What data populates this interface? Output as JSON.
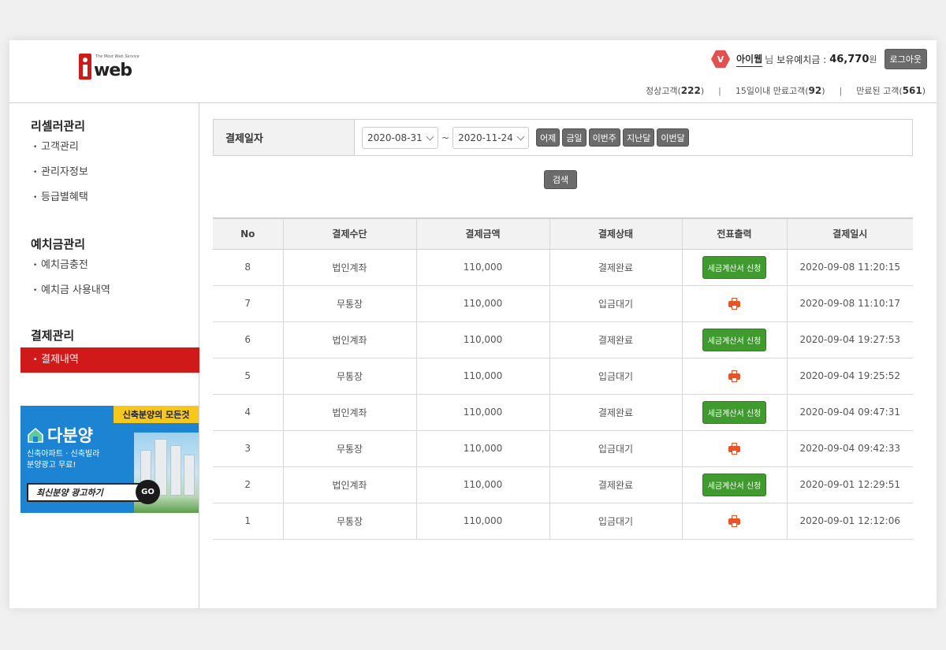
{
  "header": {
    "logo_text": "web",
    "logo_tagline": "The Most Web Service",
    "vip_badge": "V",
    "user_name": "아이웹",
    "user_suffix": "님",
    "deposit_label": "보유예치금 :",
    "deposit_value": "46,770",
    "deposit_unit": "원",
    "logout_label": "로그아웃",
    "stats": [
      {
        "label": "정상고객",
        "count": "222"
      },
      {
        "label": "15일이내 만료고객",
        "count": "92"
      },
      {
        "label": "만료된 고객",
        "count": "561"
      }
    ],
    "stats_separator": "|"
  },
  "sidebar": {
    "groups": [
      {
        "title": "리셀러관리",
        "items": [
          "고객관리",
          "관리자정보",
          "등급별혜택"
        ]
      },
      {
        "title": "예치금관리",
        "items": [
          "예치금충전",
          "예치금 사용내역"
        ]
      },
      {
        "title": "결제관리",
        "items": [
          "결제내역"
        ]
      }
    ],
    "active_item": "결제내역"
  },
  "banner": {
    "top_label": "신축분양의 모든것",
    "brand": "다분양",
    "subtitle_line1": "신축아파트 · 신축빌라",
    "subtitle_line2": "분양광고 무료!",
    "cta": "최신분양 광고하기",
    "go": "GO"
  },
  "search": {
    "label": "결제일자",
    "date_from": "2020-08-31",
    "date_to": "2020-11-24",
    "tilde": "~",
    "quick_buttons": [
      "어제",
      "금일",
      "이번주",
      "지난달",
      "이번달"
    ],
    "submit_label": "검색"
  },
  "table": {
    "columns": [
      "No",
      "결제수단",
      "결제금액",
      "결제상태",
      "전표출력",
      "결제일시"
    ],
    "tax_button_label": "세금계산서 신청",
    "rows": [
      {
        "no": "8",
        "method": "법인계좌",
        "amount": "110,000",
        "status": "결제완료",
        "receipt": "tax",
        "datetime": "2020-09-08 11:20:15"
      },
      {
        "no": "7",
        "method": "무통장",
        "amount": "110,000",
        "status": "입금대기",
        "receipt": "print",
        "datetime": "2020-09-08 11:10:17"
      },
      {
        "no": "6",
        "method": "법인계좌",
        "amount": "110,000",
        "status": "결제완료",
        "receipt": "tax",
        "datetime": "2020-09-04 19:27:53"
      },
      {
        "no": "5",
        "method": "무통장",
        "amount": "110,000",
        "status": "입금대기",
        "receipt": "print",
        "datetime": "2020-09-04 19:25:52"
      },
      {
        "no": "4",
        "method": "법인계좌",
        "amount": "110,000",
        "status": "결제완료",
        "receipt": "tax",
        "datetime": "2020-09-04 09:47:31"
      },
      {
        "no": "3",
        "method": "무통장",
        "amount": "110,000",
        "status": "입금대기",
        "receipt": "print",
        "datetime": "2020-09-04 09:42:33"
      },
      {
        "no": "2",
        "method": "법인계좌",
        "amount": "110,000",
        "status": "결제완료",
        "receipt": "tax",
        "datetime": "2020-09-01 12:29:51"
      },
      {
        "no": "1",
        "method": "무통장",
        "amount": "110,000",
        "status": "입금대기",
        "receipt": "print",
        "datetime": "2020-09-01 12:12:06"
      }
    ]
  },
  "colors": {
    "brand_red": "#d01a1a",
    "button_gray": "#6b6b6b",
    "tax_green": "#3f9b2d",
    "print_orange": "#e8542a",
    "banner_blue": "#1c84d2",
    "banner_yellow": "#f6c71c"
  },
  "icons": {
    "vip": "vip-badge-icon",
    "chevron": "chevron-down-icon",
    "print": "printer-icon",
    "house": "house-icon"
  }
}
